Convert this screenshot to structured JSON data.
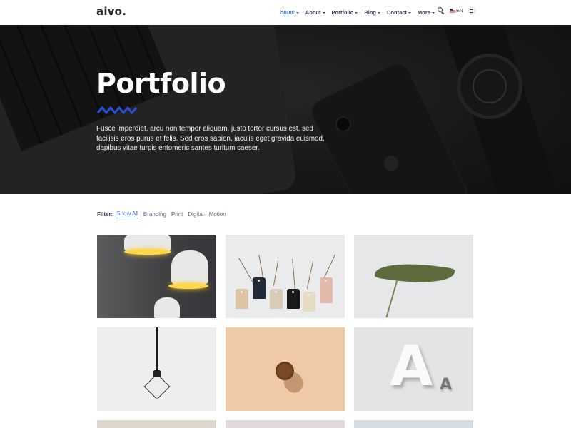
{
  "brand": {
    "logo": "aivo."
  },
  "nav": {
    "items": [
      {
        "label": "Home",
        "active": true
      },
      {
        "label": "About"
      },
      {
        "label": "Portfolio"
      },
      {
        "label": "Blog"
      },
      {
        "label": "Contact"
      },
      {
        "label": "More"
      }
    ],
    "language": "EN",
    "icons": [
      "search-icon",
      "flag-icon",
      "menu-icon"
    ]
  },
  "hero": {
    "title": "Portfolio",
    "text": "Fusce imperdiet, arcu non tempor aliquam, justo tortor cursus est, sed facilisis eros purus et felis. Sed eros sapien, iaculis eget gravida euismod, dapibus vitae turpis entomeric santes turitum caeser.",
    "accent_color": "#2a4fd6"
  },
  "filter": {
    "label": "Filter:",
    "items": [
      "Show All",
      "Branding",
      "Print",
      "Digital",
      "Motion"
    ],
    "active_index": 0
  },
  "colors": {
    "primary": "#3f78e0",
    "text": "#343f52",
    "muted": "#60697b"
  }
}
